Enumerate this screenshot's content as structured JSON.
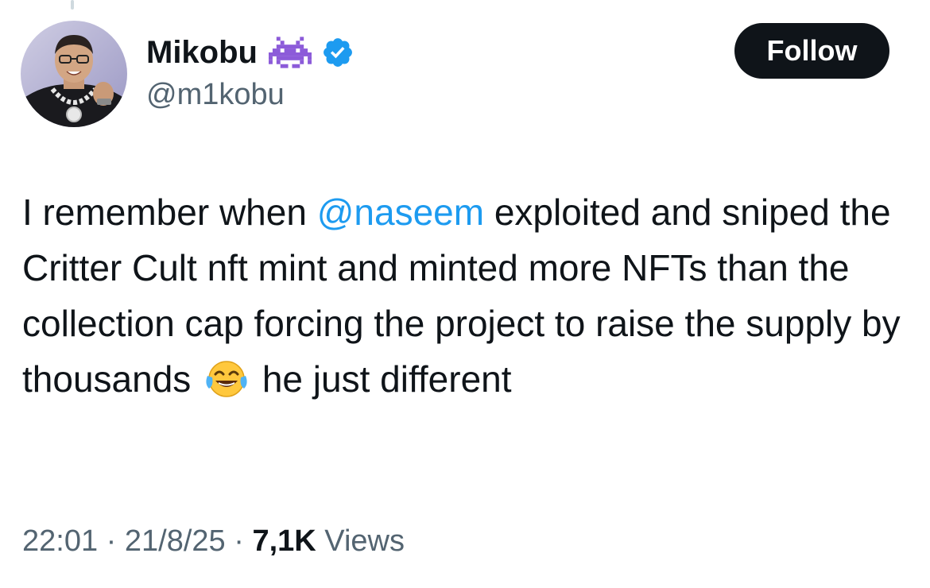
{
  "author": {
    "display_name": "Mikobu",
    "handle": "@m1kobu",
    "name_badge_icon": "space-invader-icon",
    "verified_icon": "verified-badge-icon",
    "verified_color": "#1d9bf0"
  },
  "follow_button": {
    "label": "Follow"
  },
  "tweet": {
    "text_before_mention": "I remember when ",
    "mention": "@naseem",
    "text_after_mention": " exploited and sniped the Critter Cult nft mint and minted more NFTs than the collection cap forcing the project to raise the supply by thousands",
    "emoji_icon": "face-with-tears-of-joy-icon",
    "text_after_emoji": "he just different"
  },
  "meta": {
    "time": "22:01",
    "separator": "·",
    "date": "21/8/25",
    "views_count": "7,1K",
    "views_label": "Views"
  },
  "colors": {
    "text_primary": "#0f1419",
    "text_secondary": "#536471",
    "link": "#1d9bf0",
    "follow_bg": "#0f1419",
    "follow_text": "#ffffff"
  }
}
